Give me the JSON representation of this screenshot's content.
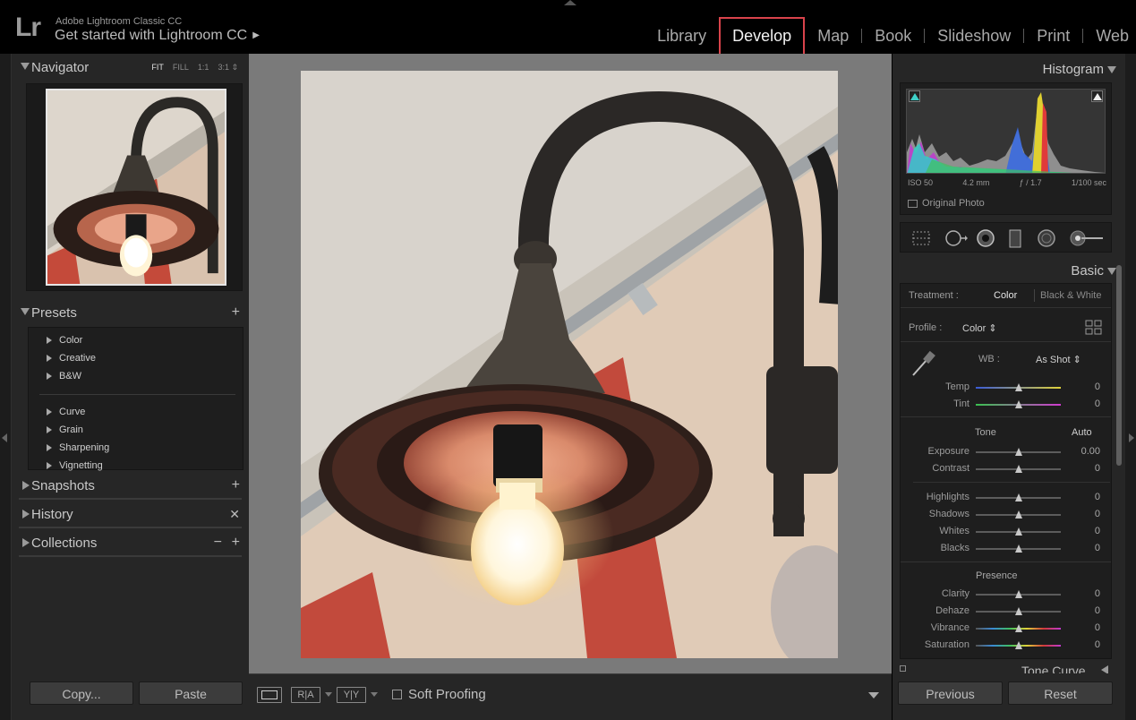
{
  "app": {
    "logo": "Lr",
    "name": "Adobe Lightroom Classic CC",
    "identity_plate": "Get started with Lightroom CC"
  },
  "modules": [
    {
      "label": "Library",
      "active": false
    },
    {
      "label": "Develop",
      "active": true
    },
    {
      "label": "Map",
      "active": false
    },
    {
      "label": "Book",
      "active": false
    },
    {
      "label": "Slideshow",
      "active": false
    },
    {
      "label": "Print",
      "active": false
    },
    {
      "label": "Web",
      "active": false
    }
  ],
  "left_panel": {
    "navigator": {
      "title": "Navigator",
      "zoom": {
        "fit": "FIT",
        "fill": "FILL",
        "one": "1:1",
        "three": "3:1"
      }
    },
    "presets": {
      "title": "Presets",
      "group1": [
        "Color",
        "Creative",
        "B&W"
      ],
      "group2": [
        "Curve",
        "Grain",
        "Sharpening",
        "Vignetting"
      ]
    },
    "snapshots": {
      "title": "Snapshots"
    },
    "history": {
      "title": "History"
    },
    "collections": {
      "title": "Collections"
    },
    "copy_label": "Copy...",
    "paste_label": "Paste"
  },
  "toolbar": {
    "soft_proofing": "Soft Proofing",
    "before_after_ra": "R|A",
    "before_after_yy": "Y|Y"
  },
  "right_panel": {
    "histogram": {
      "title": "Histogram",
      "iso": "ISO 50",
      "focal": "4.2 mm",
      "aperture": "ƒ / 1.7",
      "shutter": "1/100 sec",
      "original_photo": "Original Photo"
    },
    "basic": {
      "title": "Basic",
      "treatment_label": "Treatment :",
      "treatment_color": "Color",
      "treatment_bw": "Black & White",
      "profile_label": "Profile :",
      "profile_value": "Color",
      "wb_label": "WB :",
      "wb_value": "As Shot",
      "tone_label": "Tone",
      "auto_label": "Auto",
      "presence_label": "Presence",
      "sliders_wb": [
        {
          "label": "Temp",
          "value": "0"
        },
        {
          "label": "Tint",
          "value": "0"
        }
      ],
      "sliders_tone1": [
        {
          "label": "Exposure",
          "value": "0.00"
        },
        {
          "label": "Contrast",
          "value": "0"
        }
      ],
      "sliders_tone2": [
        {
          "label": "Highlights",
          "value": "0"
        },
        {
          "label": "Shadows",
          "value": "0"
        },
        {
          "label": "Whites",
          "value": "0"
        },
        {
          "label": "Blacks",
          "value": "0"
        }
      ],
      "sliders_presence": [
        {
          "label": "Clarity",
          "value": "0"
        },
        {
          "label": "Dehaze",
          "value": "0"
        },
        {
          "label": "Vibrance",
          "value": "0"
        },
        {
          "label": "Saturation",
          "value": "0"
        }
      ]
    },
    "tone_curve_title": "Tone Curve",
    "previous_label": "Previous",
    "reset_label": "Reset"
  },
  "colors": {
    "highlight_border": "#d9434b",
    "panel_bg": "#262626",
    "canvas_bg": "#7a7a7a"
  }
}
